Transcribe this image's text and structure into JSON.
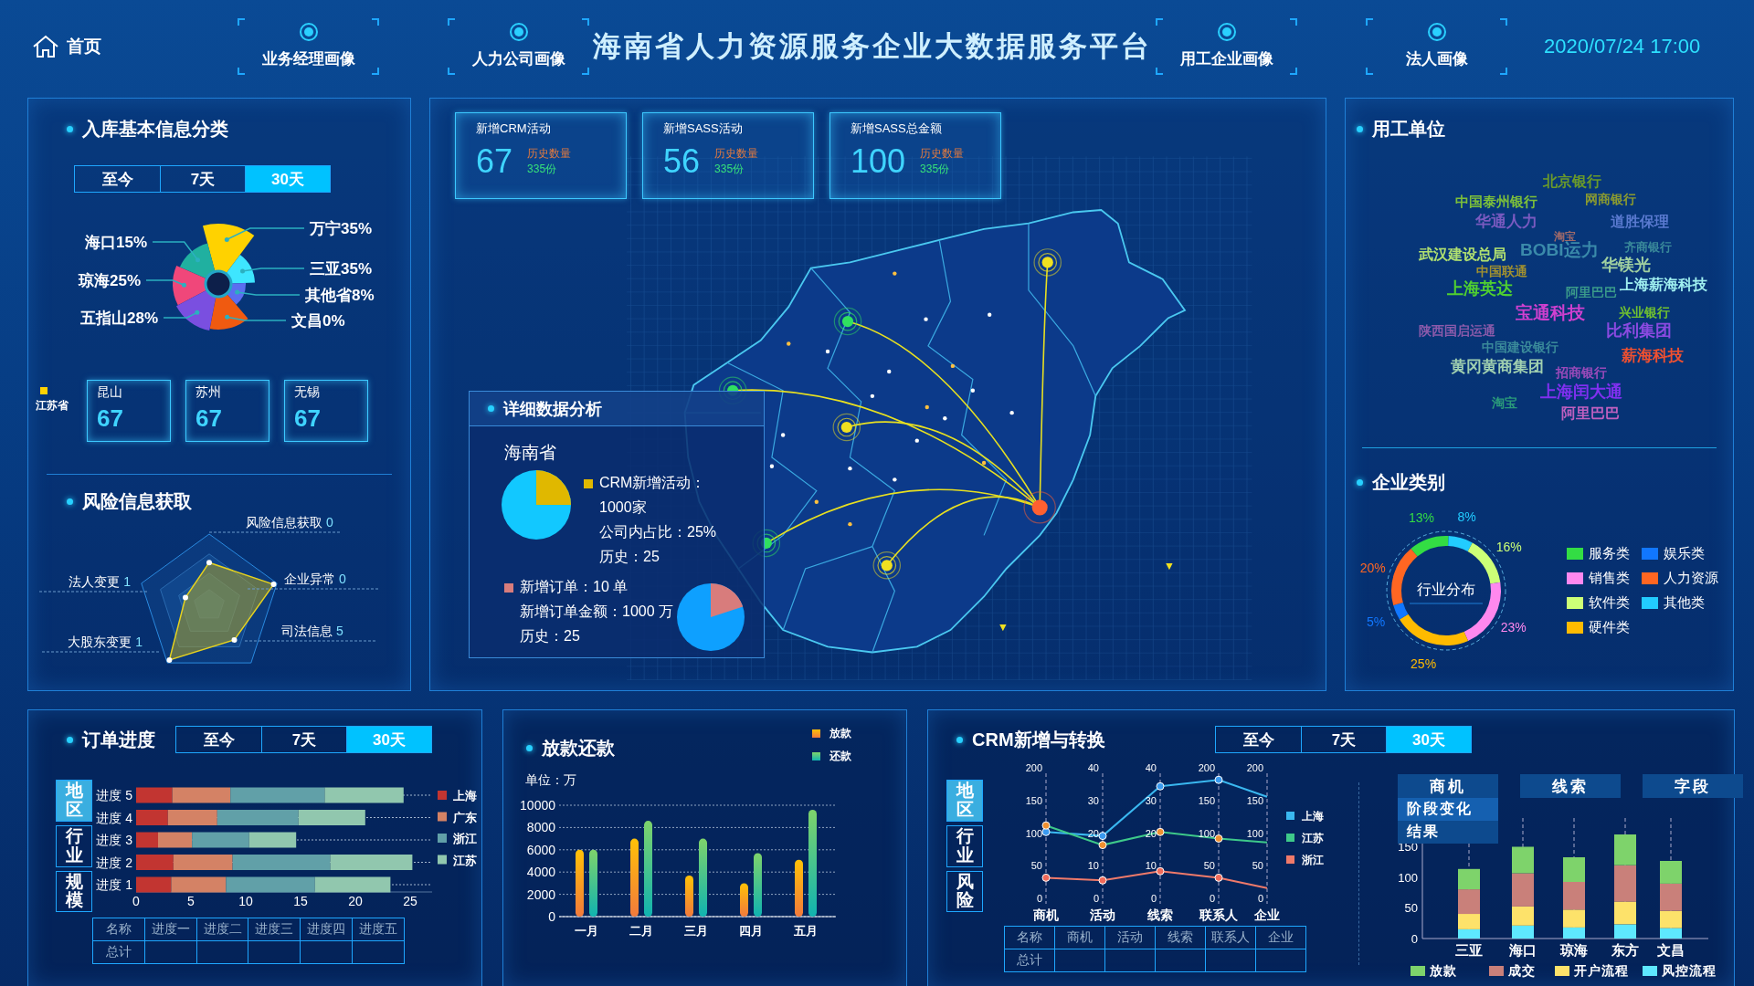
{
  "header": {
    "home": "首页",
    "nav_left": [
      {
        "label": "业务经理画像"
      },
      {
        "label": "人力公司画像"
      }
    ],
    "title": "海南省人力资源服务企业大数据服务平台",
    "nav_right": [
      {
        "label": "用工企业画像"
      },
      {
        "label": "法人画像"
      }
    ],
    "datetime": "2020/07/24 17:00"
  },
  "category_panel": {
    "title": "入库基本信息分类",
    "tabs": [
      {
        "label": "至今",
        "selected": false
      },
      {
        "label": "7天",
        "selected": false
      },
      {
        "label": "30天",
        "selected": true
      }
    ],
    "slices": [
      {
        "label": "万宁35%"
      },
      {
        "label": "三亚35%"
      },
      {
        "label": "其他省8%"
      },
      {
        "label": "文昌0%"
      },
      {
        "label": "海口15%"
      },
      {
        "label": "琼海25%"
      },
      {
        "label": "五指山28%"
      }
    ],
    "province": "江苏省",
    "cities": [
      {
        "name": "昆山",
        "value": "67"
      },
      {
        "name": "苏州",
        "value": "67"
      },
      {
        "name": "无锡",
        "value": "67"
      }
    ]
  },
  "risk_panel": {
    "title": "风险信息获取",
    "radar": [
      {
        "label": "风险信息获取",
        "value": "0"
      },
      {
        "label": "企业异常",
        "value": "0"
      },
      {
        "label": "司法信息",
        "value": "5"
      },
      {
        "label": "大股东变更",
        "value": "1"
      },
      {
        "label": "法人变更",
        "value": "1"
      }
    ]
  },
  "stats": [
    {
      "title": "新增CRM活动",
      "value": "67",
      "history_label": "历史数量",
      "history_value": "335份"
    },
    {
      "title": "新增SASS活动",
      "value": "56",
      "history_label": "历史数量",
      "history_value": "335份"
    },
    {
      "title": "新增SASS总金额",
      "value": "100",
      "history_label": "历史数量",
      "history_value": "335份"
    }
  ],
  "detail": {
    "title": "详细数据分析",
    "region": "海南省",
    "crm_label": "CRM新增活动：",
    "crm_lines": [
      "1000家",
      "公司内占比：25%",
      "历史：25"
    ],
    "order_label": "新增订单：10 单",
    "order_lines": [
      "新增订单金额：1000 万",
      "历史：25"
    ]
  },
  "company_panel": {
    "title": "用工单位",
    "words": [
      {
        "text": "北京银行",
        "color": "#6a9a2a"
      },
      {
        "text": "中国泰州银行",
        "color": "#7cbf3a"
      },
      {
        "text": "网商银行",
        "color": "#8a9a30"
      },
      {
        "text": "华通人力",
        "color": "#7a5ac0"
      },
      {
        "text": "道胜保理",
        "color": "#5a7ad0"
      },
      {
        "text": "淘宝",
        "color": "#a06a6a"
      },
      {
        "text": "武汉建设总局",
        "color": "#b0e070"
      },
      {
        "text": "BOBI运力",
        "color": "#3a8aaa"
      },
      {
        "text": "齐商银行",
        "color": "#3a8a9a"
      },
      {
        "text": "华镁光",
        "color": "#a0d0a0"
      },
      {
        "text": "中国联通",
        "color": "#a09030"
      },
      {
        "text": "上海英达",
        "color": "#50d030"
      },
      {
        "text": "阿里巴巴",
        "color": "#3a9a8a"
      },
      {
        "text": "上海薪海科技",
        "color": "#a0f0f0"
      },
      {
        "text": "宝通科技",
        "color": "#d040d0"
      },
      {
        "text": "兴业银行",
        "color": "#70c030"
      },
      {
        "text": "陕西国启运通",
        "color": "#8a5aaa"
      },
      {
        "text": "比利集团",
        "color": "#8a4ae0"
      },
      {
        "text": "中国建设银行",
        "color": "#3a8a9a"
      },
      {
        "text": "黄冈黄商集团",
        "color": "#a0d0b0"
      },
      {
        "text": "薪海科技",
        "color": "#f05030"
      },
      {
        "text": "招商银行",
        "color": "#9a4aba"
      },
      {
        "text": "上海闰大通",
        "color": "#8030f0"
      },
      {
        "text": "淘宝",
        "color": "#2a9a7a"
      },
      {
        "text": "阿里巴巴",
        "color": "#c060c0"
      }
    ]
  },
  "type_panel": {
    "title": "企业类别",
    "chart_data": {
      "type": "donut",
      "title": "行业分布",
      "categories": [
        "服务类",
        "其他类",
        "软件类",
        "销售类",
        "硬件类",
        "娱乐类",
        "人力资源"
      ],
      "values": [
        13,
        8,
        16,
        23,
        25,
        5,
        20
      ],
      "value_labels": [
        "13%",
        "8%",
        "16%",
        "23%",
        "25%",
        "5%",
        "20%"
      ]
    },
    "legend": [
      {
        "color": "#33dd44"
      },
      {
        "color": "#22ccff"
      },
      {
        "color": "#ccff77"
      },
      {
        "color": "#ff88ee"
      },
      {
        "color": "#ffbb00"
      },
      {
        "color": "#1177ff"
      },
      {
        "color": "#ff6622"
      }
    ]
  },
  "order_panel": {
    "title": "订单进度",
    "tabs": [
      {
        "label": "至今",
        "selected": false
      },
      {
        "label": "7天",
        "selected": false
      },
      {
        "label": "30天",
        "selected": true
      }
    ],
    "side_tabs": [
      {
        "label": "地区",
        "selected": true
      },
      {
        "label": "行业",
        "selected": false
      },
      {
        "label": "规模",
        "selected": false
      }
    ],
    "chart_data": {
      "type": "bar",
      "orientation": "horizontal",
      "stacked": true,
      "categories": [
        "进度 5",
        "进度 4",
        "进度 3",
        "进度 2",
        "进度 1"
      ],
      "series": [
        {
          "name": "上海",
          "color": "#c23531",
          "values": [
            3.3,
            2.9,
            2,
            3.4,
            3.2
          ]
        },
        {
          "name": "广东",
          "color": "#d48265",
          "values": [
            5.3,
            4.5,
            3.1,
            5.4,
            5
          ]
        },
        {
          "name": "浙江",
          "color": "#61a0a8",
          "values": [
            8.6,
            7.4,
            5.2,
            8.9,
            8.1
          ]
        },
        {
          "name": "江苏",
          "color": "#91c7ae",
          "values": [
            7.2,
            6.1,
            4.3,
            7.5,
            6.9
          ]
        }
      ],
      "xlim": [
        0,
        27
      ],
      "xticks": [
        0,
        5,
        10,
        15,
        20,
        25
      ],
      "grid": true,
      "legend": "right"
    },
    "table": {
      "columns": [
        "名称",
        "进度一",
        "进度二",
        "进度三",
        "进度四",
        "进度五"
      ],
      "row_label": "总计"
    }
  },
  "loan_panel": {
    "title": "放款还款",
    "chart_data": {
      "type": "bar",
      "ylabel": "单位：万",
      "categories": [
        "一月",
        "二月",
        "三月",
        "四月",
        "五月"
      ],
      "series": [
        {
          "name": "放款",
          "color": "#ffc107",
          "values": [
            6000,
            7000,
            3700,
            3000,
            5100
          ]
        },
        {
          "name": "还款",
          "color": "#7ed36b",
          "values": [
            6000,
            8600,
            7000,
            5700,
            9600
          ]
        }
      ],
      "ylim": [
        0,
        10000
      ],
      "yticks": [
        0,
        2000,
        4000,
        6000,
        8000,
        10000
      ],
      "grid": true,
      "legend": "top"
    }
  },
  "crm_panel": {
    "title": "CRM新增与转换",
    "tabs": [
      {
        "label": "至今",
        "selected": false
      },
      {
        "label": "7天",
        "selected": false
      },
      {
        "label": "30天",
        "selected": true
      }
    ],
    "side_tabs": [
      {
        "label": "地区",
        "selected": true
      },
      {
        "label": "行业",
        "selected": false
      },
      {
        "label": "风险",
        "selected": false
      }
    ],
    "axes": [
      {
        "name": "商机",
        "ticks": [
          "200",
          "150",
          "100",
          "50",
          "0"
        ]
      },
      {
        "name": "活动",
        "ticks": [
          "40",
          "30",
          "20",
          "10",
          "0"
        ]
      },
      {
        "name": "线索",
        "ticks": [
          "40",
          "30",
          "20",
          "10",
          "0"
        ]
      },
      {
        "name": "联系人",
        "ticks": [
          "200",
          "150",
          "100",
          "50",
          "0"
        ]
      },
      {
        "name": "企业",
        "ticks": [
          "200",
          "150",
          "100",
          "50",
          "0"
        ]
      }
    ],
    "lines": [
      {
        "name": "上海",
        "color": "#3ab8f0"
      },
      {
        "name": "江苏",
        "color": "#3ec98a"
      },
      {
        "name": "浙江",
        "color": "#f07a6a"
      }
    ],
    "table": {
      "columns": [
        "名称",
        "商机",
        "活动",
        "线索",
        "联系人",
        "企业"
      ],
      "row_label": "总计"
    },
    "stage_tabs": [
      {
        "label": "商机"
      },
      {
        "label": "线索"
      },
      {
        "label": "字段"
      }
    ],
    "stage_menu": [
      "阶段变化",
      "结果"
    ],
    "chart_data": {
      "type": "bar",
      "stacked": true,
      "categories": [
        "三亚",
        "海口",
        "琼海",
        "东方",
        "文昌"
      ],
      "series": [
        {
          "name": "放款",
          "color": "#7ed36b",
          "values": [
            33,
            43,
            40,
            50,
            37
          ]
        },
        {
          "name": "成交",
          "color": "#c9807a",
          "values": [
            40,
            54,
            45,
            59,
            44
          ]
        },
        {
          "name": "开户流程",
          "color": "#fde26a",
          "values": [
            25,
            31,
            29,
            37,
            28
          ]
        },
        {
          "name": "风控流程",
          "color": "#5ee8ff",
          "values": [
            15,
            21,
            18,
            23,
            17
          ]
        }
      ],
      "ylim": [
        0,
        175
      ],
      "yticks": [
        0,
        50,
        100,
        150
      ],
      "grid": true,
      "legend": "bottom"
    }
  }
}
